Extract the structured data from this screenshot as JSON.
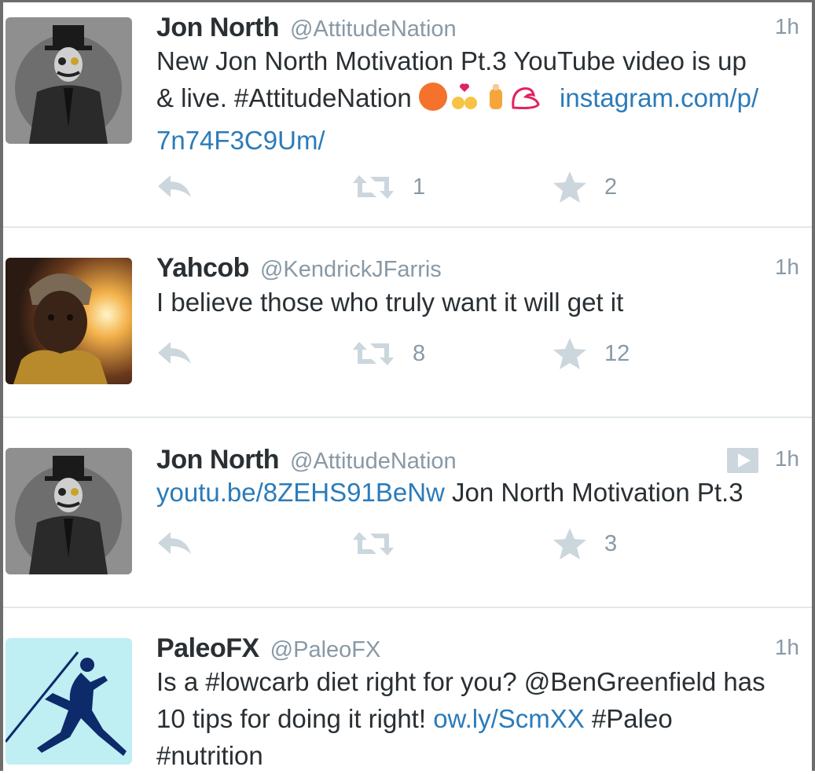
{
  "tweets": [
    {
      "name": "Jon North",
      "handle": "@AttitudeNation",
      "time": "1h",
      "line1": "New Jon North Motivation Pt.3 YouTube video is up",
      "line2_text": "& live. #AttitudeNation",
      "line2_link": "instagram.com/p/",
      "line3_link": "7n74F3C9Um/",
      "retweets": "1",
      "favorites": "2"
    },
    {
      "name": "Yahcob",
      "handle": "@KendrickJFarris",
      "time": "1h",
      "line1": "I believe those who truly want it will get it",
      "retweets": "8",
      "favorites": "12"
    },
    {
      "name": "Jon North",
      "handle": "@AttitudeNation",
      "time": "1h",
      "link": "youtu.be/8ZEHS91BeNw",
      "text": " Jon North Motivation Pt.3",
      "retweets": "",
      "favorites": "3"
    },
    {
      "name": "PaleoFX",
      "handle": "@PaleoFX",
      "time": "1h",
      "line1": "Is a #lowcarb diet right for you? @BenGreenfield has",
      "line2_text": "10 tips for doing it right! ",
      "line2_link": "ow.ly/ScmXX",
      "line2_after": " #Paleo",
      "line3": "#nutrition"
    }
  ],
  "icons": {
    "reply": "reply-icon",
    "retweet": "retweet-icon",
    "favorite": "star-icon",
    "media": "play-icon"
  },
  "colors": {
    "link": "#2b7bb9",
    "meta": "#8899a6",
    "action": "#ccd6dd",
    "divider": "#e1e8ed"
  }
}
